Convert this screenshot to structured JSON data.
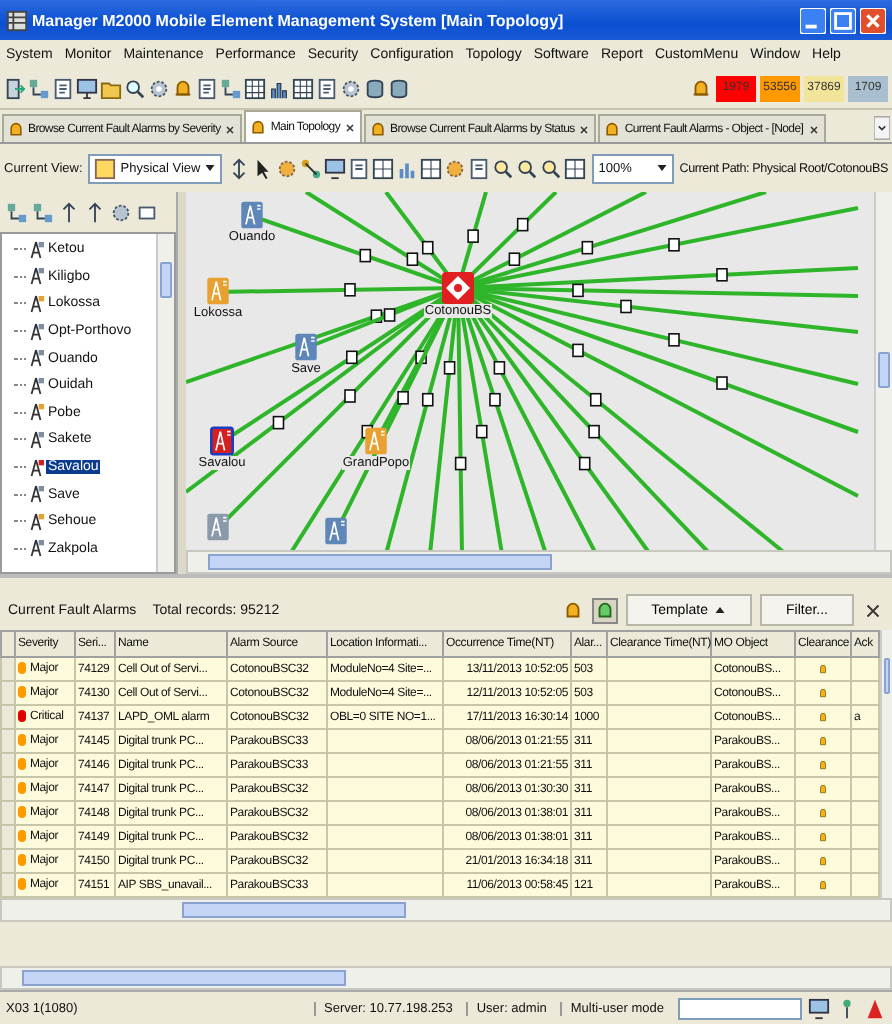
{
  "window": {
    "title": "Manager M2000 Mobile Element Management System [Main Topology]"
  },
  "menu": [
    "System",
    "Monitor",
    "Maintenance",
    "Performance",
    "Security",
    "Configuration",
    "Topology",
    "Software",
    "Report",
    "CustomMenu",
    "Window",
    "Help"
  ],
  "alarm_counters": [
    {
      "count": "1979",
      "color": "#ff0000"
    },
    {
      "count": "53556",
      "color": "#ff9900"
    },
    {
      "count": "37869",
      "color": "#f2e59a"
    },
    {
      "count": "1709",
      "color": "#a9bfcf"
    }
  ],
  "tabs": [
    {
      "label": "Browse Current Fault Alarms by Severity",
      "selected": false
    },
    {
      "label": "Main Topology",
      "selected": true
    },
    {
      "label": "Browse Current Fault Alarms by Status",
      "selected": false
    },
    {
      "label": "Current Fault Alarms - Object - [Node]",
      "selected": false
    }
  ],
  "view_bar": {
    "label": "Current View:",
    "view": "Physical View",
    "zoom": "100%",
    "path": "Current Path: Physical Root/CotonouBS"
  },
  "tree": {
    "items": [
      {
        "label": "Ketou",
        "color": "#7d8fa3",
        "selected": false
      },
      {
        "label": "Kiligbo",
        "color": "#7d8fa3",
        "selected": false
      },
      {
        "label": "Lokossa",
        "color": "#e8a030",
        "selected": false
      },
      {
        "label": "Opt-Porthovo",
        "color": "#7d8fa3",
        "selected": false
      },
      {
        "label": "Ouando",
        "color": "#7d8fa3",
        "selected": false
      },
      {
        "label": "Ouidah",
        "color": "#7d8fa3",
        "selected": false
      },
      {
        "label": "Pobe",
        "color": "#e8a030",
        "selected": false
      },
      {
        "label": "Sakete",
        "color": "#7d8fa3",
        "selected": false
      },
      {
        "label": "Savalou",
        "color": "#d42020",
        "selected": true
      },
      {
        "label": "Save",
        "color": "#7d8fa3",
        "selected": false
      },
      {
        "label": "Sehoue",
        "color": "#e8a030",
        "selected": false
      },
      {
        "label": "Zakpola",
        "color": "#7d8fa3",
        "selected": false
      }
    ]
  },
  "topology": {
    "nodes": [
      {
        "kind": "hub",
        "label": "CotonouBS",
        "color": "#e02020",
        "selected": false
      },
      {
        "kind": "site",
        "label": "Ouando",
        "color": "#5f86b8",
        "selected": false
      },
      {
        "kind": "site",
        "label": "Lokossa",
        "color": "#e8a030",
        "selected": false
      },
      {
        "kind": "site",
        "label": "Save",
        "color": "#5f86b8",
        "selected": false
      },
      {
        "kind": "site",
        "label": "Savalou",
        "color": "#d42020",
        "selected": true
      },
      {
        "kind": "site",
        "label": "GrandPopo",
        "color": "#e8a030",
        "selected": false
      },
      {
        "kind": "site",
        "color": "#8a9aab",
        "selected": false
      },
      {
        "kind": "site",
        "color": "#5f86b8",
        "selected": false
      }
    ]
  },
  "alarms": {
    "title": "Current Fault Alarms",
    "total": "Total records: 95212",
    "template_button": "Template",
    "filter_button": "Filter...",
    "columns": [
      "Severity",
      "Seri...",
      "Name",
      "Alarm Source",
      "Location Informati...",
      "Occurrence Time(NT)",
      "Alar...",
      "Clearance Time(NT)",
      "MO Object",
      "Clearance",
      "Ack"
    ],
    "rows": [
      {
        "color": "#ff9900",
        "severity": "Major",
        "serial": "74129",
        "name": "Cell Out of Servi...",
        "source": "CotonouBSC32",
        "location": "ModuleNo=4 Site=...",
        "occurred": "13/11/2013 10:52:05",
        "code": "503",
        "mo": "CotonouBS..."
      },
      {
        "color": "#ff9900",
        "severity": "Major",
        "serial": "74130",
        "name": "Cell Out of Servi...",
        "source": "CotonouBSC32",
        "location": "ModuleNo=4 Site=...",
        "occurred": "12/11/2013 10:52:05",
        "code": "503",
        "mo": "CotonouBS..."
      },
      {
        "color": "#e00000",
        "severity": "Critical",
        "serial": "74137",
        "name": "LAPD_OML alarm",
        "source": "CotonouBSC32",
        "location": "OBL=0 SITE NO=1...",
        "occurred": "17/11/2013 16:30:14",
        "code": "1000",
        "mo": "CotonouBS...",
        "ack": "a"
      },
      {
        "color": "#ff9900",
        "severity": "Major",
        "serial": "74145",
        "name": "Digital trunk PC...",
        "source": "ParakouBSC33",
        "occurred": "08/06/2013 01:21:55",
        "code": "311",
        "mo": "ParakouBS..."
      },
      {
        "color": "#ff9900",
        "severity": "Major",
        "serial": "74146",
        "name": "Digital trunk PC...",
        "source": "ParakouBSC33",
        "occurred": "08/06/2013 01:21:55",
        "code": "311",
        "mo": "ParakouBS..."
      },
      {
        "color": "#ff9900",
        "severity": "Major",
        "serial": "74147",
        "name": "Digital trunk PC...",
        "source": "ParakouBSC32",
        "occurred": "08/06/2013 01:30:30",
        "code": "311",
        "mo": "ParakouBS..."
      },
      {
        "color": "#ff9900",
        "severity": "Major",
        "serial": "74148",
        "name": "Digital trunk PC...",
        "source": "ParakouBSC32",
        "occurred": "08/06/2013 01:38:01",
        "code": "311",
        "mo": "ParakouBS..."
      },
      {
        "color": "#ff9900",
        "severity": "Major",
        "serial": "74149",
        "name": "Digital trunk PC...",
        "source": "ParakouBSC32",
        "occurred": "08/06/2013 01:38:01",
        "code": "311",
        "mo": "ParakouBS..."
      },
      {
        "color": "#ff9900",
        "severity": "Major",
        "serial": "74150",
        "name": "Digital trunk PC...",
        "source": "ParakouBSC32",
        "occurred": "21/01/2013 16:34:18",
        "code": "311",
        "mo": "ParakouBS..."
      },
      {
        "color": "#ff9900",
        "severity": "Major",
        "serial": "74151",
        "name": "AIP SBS_unavail...",
        "source": "ParakouBSC33",
        "occurred": "11/06/2013 00:58:45",
        "code": "121",
        "mo": "ParakouBS..."
      }
    ]
  },
  "status_bar": {
    "host": "X03 1(1080)",
    "server": "Server: 10.77.198.253",
    "user": "User: admin",
    "mode": "Multi-user mode"
  }
}
